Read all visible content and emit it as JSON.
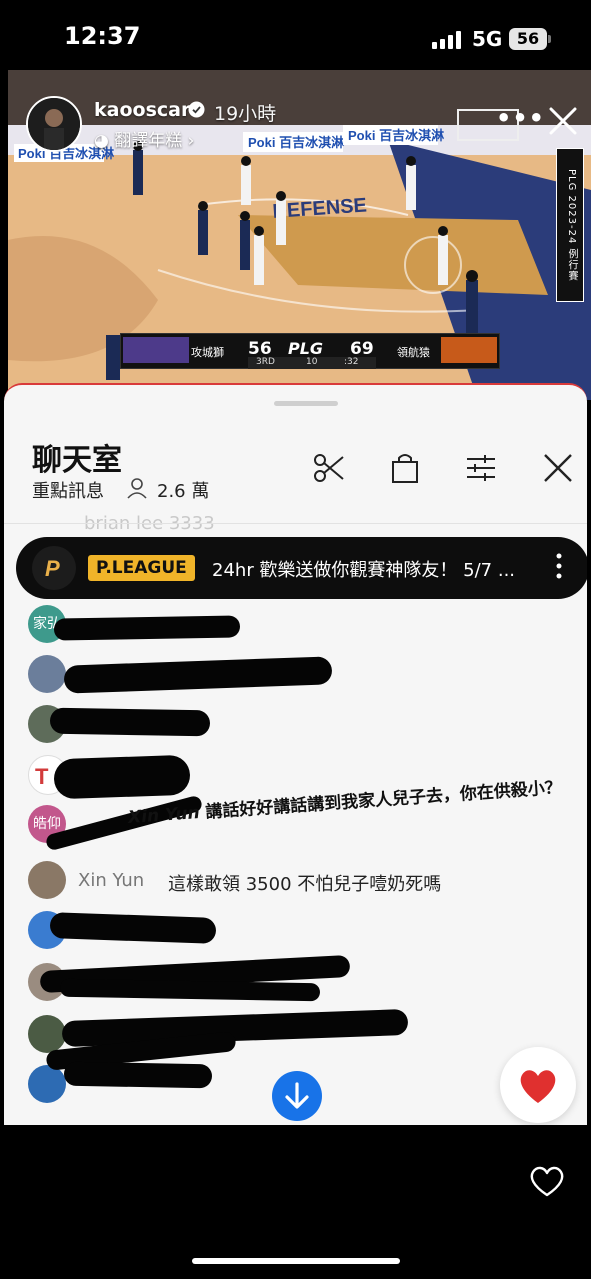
{
  "status_bar": {
    "time": "12:37",
    "network": "5G",
    "battery": "56"
  },
  "story": {
    "username": "kaooscar",
    "time_ago": "19小時",
    "translate_label": "翻譯年糕",
    "more_label": "•••",
    "scoreboard": {
      "team1_name": "攻城獅",
      "team1_score": "56",
      "league": "PLG",
      "team2_score": "69",
      "team2_name": "領航猿",
      "quarter": "3RD",
      "timeouts": "10",
      "clock": ":32"
    },
    "vertical_banner": "PLG 2023-24 例行賽",
    "court_text": "DEFENSE"
  },
  "chat": {
    "title": "聊天室",
    "subtitle": "重點訊息",
    "viewers": "2.6 萬",
    "ghost_text": "brian lee 3333",
    "pinned": {
      "badge": "P.LEAGUE",
      "text": "24hr 歡樂送做你觀賽神隊友！ 5/7 ..."
    },
    "annotation": {
      "author": "Xin Yun",
      "text": "講話好好講話講到我家人兒子去，你在供殺小？"
    },
    "messages": [
      {
        "name": "",
        "text": "",
        "avatar_label": "家弘"
      },
      {
        "name": "",
        "text": ""
      },
      {
        "name": "",
        "text": ""
      },
      {
        "name": "",
        "text": ""
      },
      {
        "name": "",
        "text": "",
        "avatar_label": "皓仰"
      },
      {
        "name": "Xin Yun",
        "text": "這樣敢領 3500 不怕兒子噎奶死嗎"
      },
      {
        "name": "",
        "text": ""
      },
      {
        "name": "",
        "text": ""
      },
      {
        "name": "",
        "text": ""
      },
      {
        "name": "",
        "text": ""
      }
    ]
  }
}
